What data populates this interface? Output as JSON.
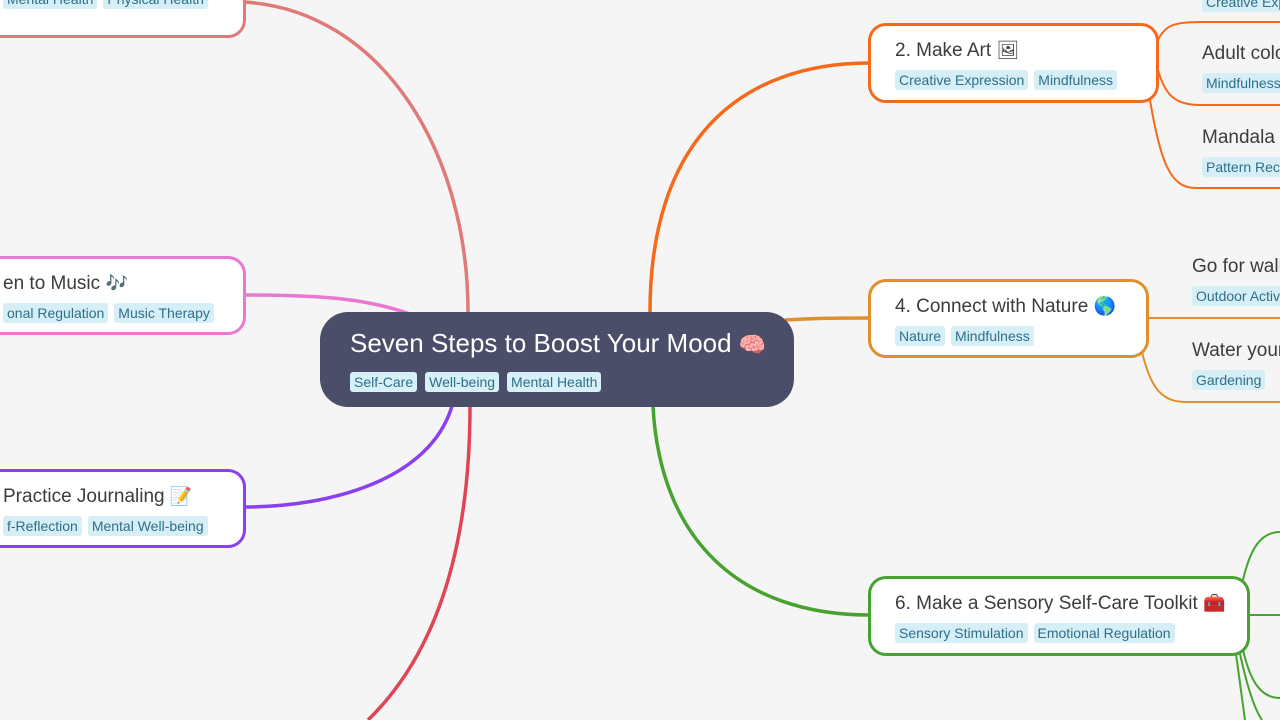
{
  "root": {
    "title": "Seven Steps to Boost Your Mood",
    "icon": "🧠",
    "tags": [
      "Self-Care",
      "Well-being",
      "Mental Health"
    ]
  },
  "branches": [
    {
      "id": "b1",
      "title": "",
      "tags": [
        "Mental Health",
        "Physical Health"
      ],
      "color": "#e07a78"
    },
    {
      "id": "b3",
      "title": "en to Music",
      "icon": "🎶",
      "tags": [
        "onal Regulation",
        "Music Therapy"
      ],
      "color": "#ea78d0"
    },
    {
      "id": "b5",
      "title": "Practice Journaling",
      "icon": "📝",
      "tags": [
        "f-Reflection",
        "Mental Well-being"
      ],
      "color": "#8a3ff0"
    },
    {
      "id": "b7",
      "title": "",
      "tags": [],
      "color": "#e04455"
    },
    {
      "id": "b2",
      "title": "2. Make Art",
      "icon": "🖼",
      "tags": [
        "Creative Expression",
        "Mindfulness"
      ],
      "color": "#f56a1a",
      "children": [
        {
          "title": "",
          "tags": [
            "Creative Exp"
          ]
        },
        {
          "title": "Adult colo",
          "tags": [
            "Mindfulness"
          ]
        },
        {
          "title": "Mandala a",
          "tags": [
            "Pattern Rec"
          ]
        }
      ]
    },
    {
      "id": "b4",
      "title": "4. Connect with Nature",
      "icon": "🌎",
      "tags": [
        "Nature",
        "Mindfulness"
      ],
      "color": "#e08f2a",
      "children": [
        {
          "title": "Go for walk",
          "tags": [
            "Outdoor Activ"
          ]
        },
        {
          "title": "Water your",
          "tags": [
            "Gardening"
          ]
        }
      ]
    },
    {
      "id": "b6",
      "title": "6. Make a Sensory Self-Care Toolkit",
      "icon": "🧰",
      "tags": [
        "Sensory Stimulation",
        "Emotional Regulation"
      ],
      "color": "#47a32f"
    }
  ]
}
